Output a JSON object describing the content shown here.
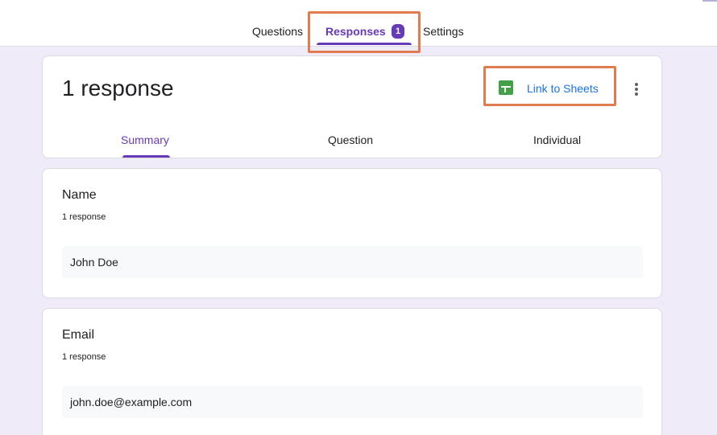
{
  "top_tabs": {
    "questions": "Questions",
    "responses": "Responses",
    "responses_badge": "1",
    "settings": "Settings"
  },
  "summary_header": {
    "response_count": "1 response",
    "link_to_sheets": "Link to Sheets",
    "tabs": {
      "summary": "Summary",
      "question": "Question",
      "individual": "Individual"
    }
  },
  "questions": [
    {
      "title": "Name",
      "count": "1 response",
      "answers": [
        "John Doe"
      ]
    },
    {
      "title": "Email",
      "count": "1 response",
      "answers": [
        "john.doe@example.com"
      ]
    }
  ],
  "colors": {
    "accent": "#673ab7",
    "background": "#f0ebf8",
    "highlight": "#e07c4f",
    "sheets_green": "#43a047",
    "link_blue": "#1a73e8"
  },
  "icons": [
    "sheets-icon",
    "more-vert-icon"
  ]
}
